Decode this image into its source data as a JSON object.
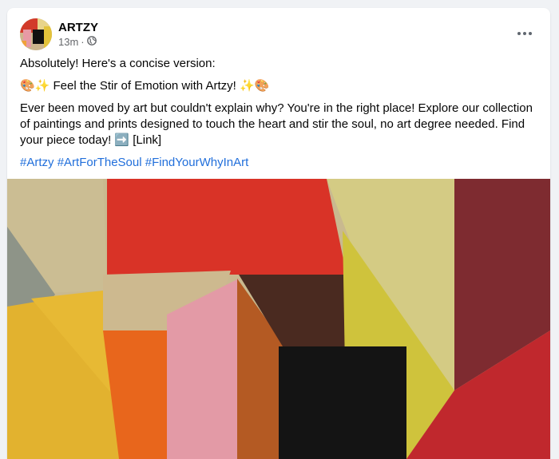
{
  "post": {
    "author": "ARTZY",
    "time": "13m",
    "separator": "·",
    "audience_icon": "globe-icon",
    "intro": "Absolutely! Here's a concise version:",
    "headline": "🎨✨ Feel the Stir of Emotion with Artzy! ✨🎨",
    "body": "Ever been moved by art but couldn't explain why? You're in the right place! Explore our collection of paintings and prints designed to touch the heart and stir the soul, no art degree needed. Find your piece today! ➡️ [Link]",
    "hashtags": [
      "#Artzy",
      "#ArtForTheSoul",
      "#FindYourWhyInArt"
    ],
    "more_icon": "more-options-icon"
  },
  "colors": {
    "link": "#216fdb",
    "secondary_text": "#65676b"
  }
}
